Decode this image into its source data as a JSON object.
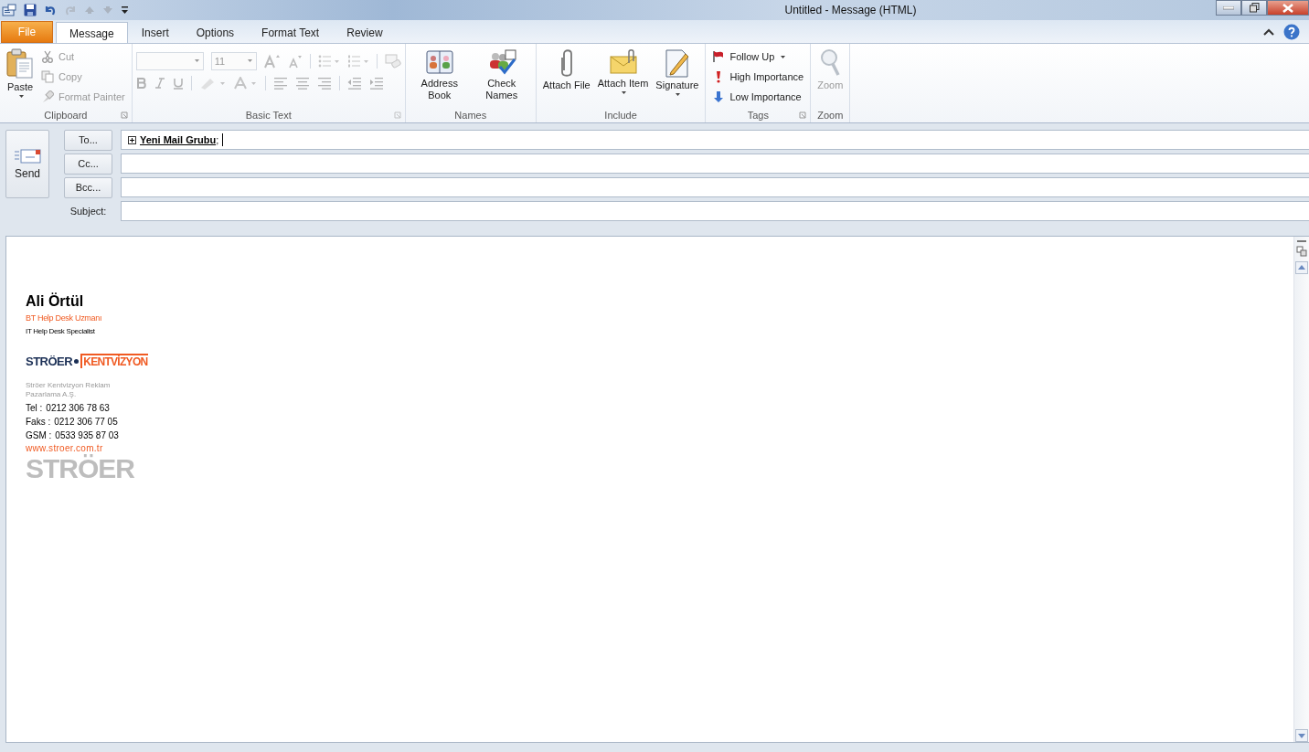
{
  "window": {
    "title": "Untitled  -  Message (HTML)"
  },
  "tabs": [
    {
      "label": "File",
      "kind": "file",
      "selected": false
    },
    {
      "label": "Message",
      "kind": "tab",
      "selected": true
    },
    {
      "label": "Insert",
      "kind": "tab",
      "selected": false
    },
    {
      "label": "Options",
      "kind": "tab",
      "selected": false
    },
    {
      "label": "Format Text",
      "kind": "tab",
      "selected": false
    },
    {
      "label": "Review",
      "kind": "tab",
      "selected": false
    }
  ],
  "ribbon": {
    "clipboard": {
      "label": "Clipboard",
      "paste": {
        "label": "Paste",
        "disabled": false
      },
      "small": [
        {
          "label": "Cut",
          "disabled": true
        },
        {
          "label": "Copy",
          "disabled": true
        },
        {
          "label": "Format Painter",
          "disabled": true
        }
      ]
    },
    "basic_text": {
      "label": "Basic Text",
      "font_size": "11",
      "disabled": true
    },
    "names": {
      "label": "Names",
      "buttons": [
        {
          "label": "Address Book",
          "disabled": false
        },
        {
          "label": "Check Names",
          "disabled": false
        }
      ]
    },
    "include": {
      "label": "Include",
      "buttons": [
        {
          "label": "Attach File",
          "dropdown": false
        },
        {
          "label": "Attach Item",
          "dropdown": true
        },
        {
          "label": "Signature",
          "dropdown": true
        }
      ]
    },
    "tags": {
      "label": "Tags",
      "small": [
        {
          "label": "Follow Up",
          "dropdown": true
        },
        {
          "label": "High Importance",
          "dropdown": false
        },
        {
          "label": "Low Importance",
          "dropdown": false
        }
      ]
    },
    "zoom": {
      "label": "Zoom",
      "button": {
        "label": "Zoom",
        "disabled": true
      }
    }
  },
  "compose": {
    "send": {
      "label": "Send"
    },
    "recipients": [
      {
        "button": "To...",
        "entries": [
          {
            "name": "Yeni Mail Grubu",
            "delimiter": ";"
          }
        ]
      },
      {
        "button": "Cc..."
      },
      {
        "button": "Bcc..."
      }
    ],
    "subject": {
      "label": "Subject:"
    }
  },
  "signature": {
    "name": "Ali Örtül",
    "title_local": "BT Help Desk Uzmanı",
    "title_en": "IT Help Desk Specialist",
    "logo": {
      "left": "STRÖER",
      "right": "KENTVİZYON"
    },
    "company": [
      "Ströer Kentvizyon Reklam",
      "Pazarlama A.Ş."
    ],
    "contacts": [
      {
        "label": "Tel :",
        "value": "0212 306 78 63"
      },
      {
        "label": "Faks :",
        "value": "0212 306 77 05"
      },
      {
        "label": "GSM :",
        "value": "0533 935 87 03"
      }
    ],
    "website": "www.stroer.com.tr",
    "footer_logo": "STRÖER"
  }
}
